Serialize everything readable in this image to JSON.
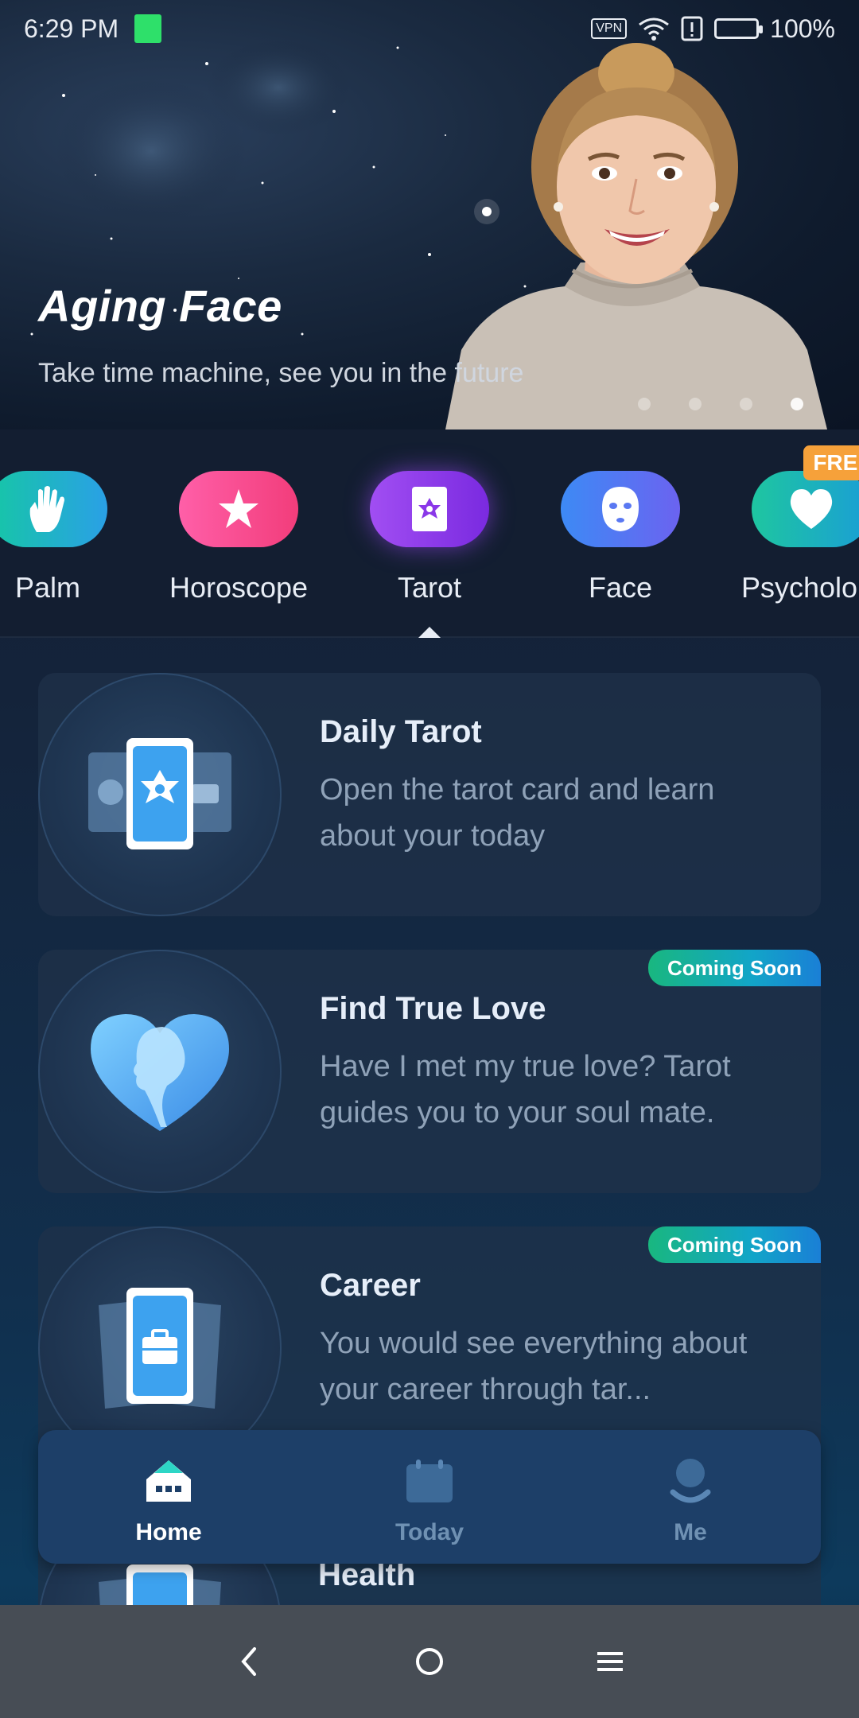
{
  "status_bar": {
    "time": "6:29 PM",
    "vpn": "VPN",
    "battery": "100%"
  },
  "banner": {
    "title": "Aging Face",
    "subtitle": "Take time machine, see you in the future",
    "dots": 4,
    "active_dot": 3
  },
  "categories": [
    {
      "label": "Palm",
      "icon": "hand-icon"
    },
    {
      "label": "Horoscope",
      "icon": "star-icon"
    },
    {
      "label": "Tarot",
      "icon": "tarot-card-icon",
      "selected": true
    },
    {
      "label": "Face",
      "icon": "face-mask-icon"
    },
    {
      "label": "Psycholo...",
      "icon": "heart-icon",
      "badge": "FREE"
    }
  ],
  "cards": [
    {
      "title": "Daily Tarot",
      "desc": "Open the tarot card and learn about your today",
      "badge": ""
    },
    {
      "title": "Find True Love",
      "desc": "Have I met my true love? Tarot guides you to your soul mate.",
      "badge": "Coming Soon"
    },
    {
      "title": "Career",
      "desc": "You would see everything about your career through tar...",
      "badge": "Coming Soon"
    },
    {
      "title": "Health"
    }
  ],
  "tabbar": [
    {
      "label": "Home",
      "icon": "home-icon",
      "active": true
    },
    {
      "label": "Today",
      "icon": "calendar-icon",
      "active": false
    },
    {
      "label": "Me",
      "icon": "profile-icon",
      "active": false
    }
  ],
  "colors": {
    "accent": "#8e3cf0",
    "coming_soon": "#19b77f",
    "free_badge": "#f6a13a",
    "tab_active": "#ffffff",
    "tab_inactive": "#6f91b3"
  }
}
